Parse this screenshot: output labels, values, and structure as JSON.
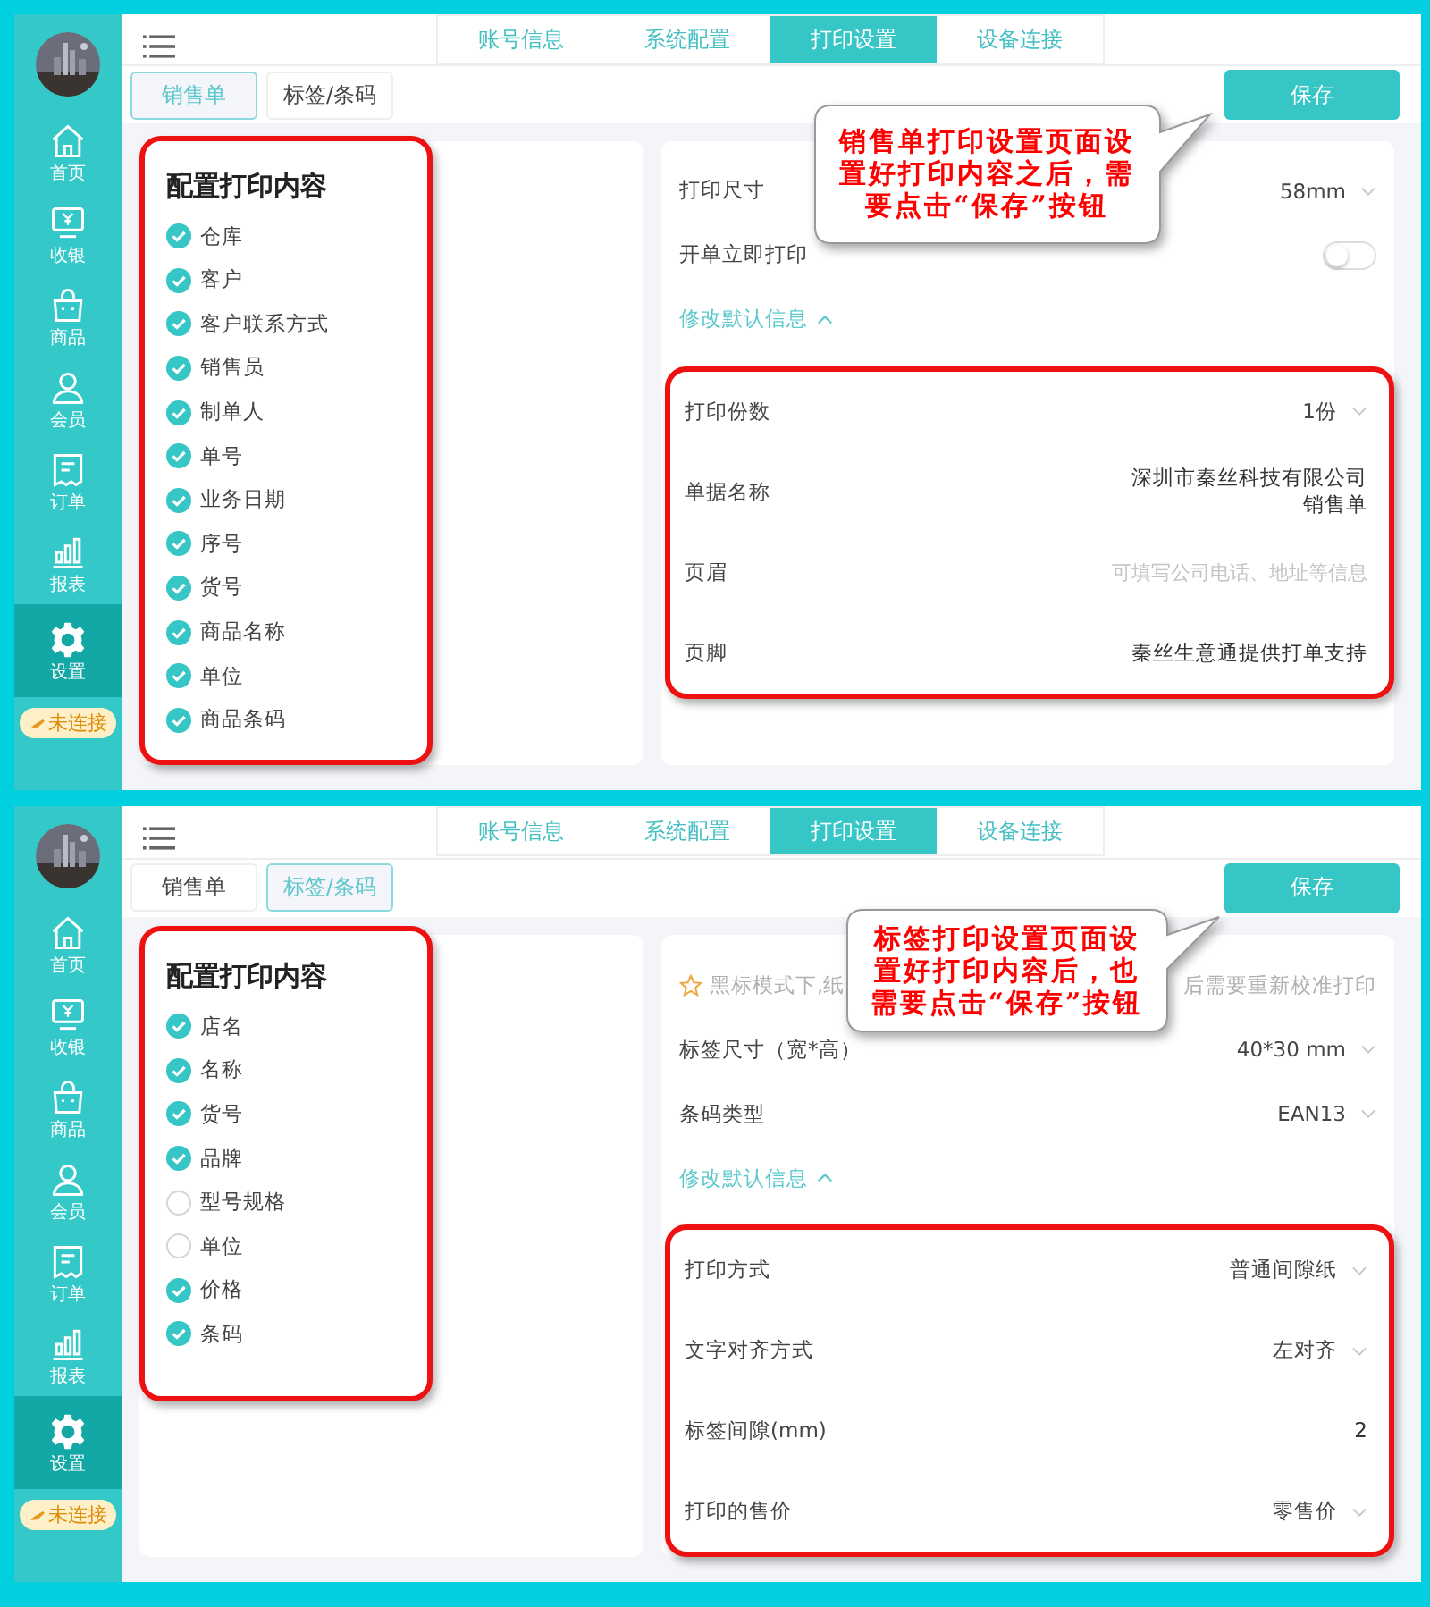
{
  "panels": [
    {
      "nav": [
        {
          "label": "首页",
          "selected": false
        },
        {
          "label": "收银",
          "selected": false
        },
        {
          "label": "商品",
          "selected": false
        },
        {
          "label": "会员",
          "selected": false
        },
        {
          "label": "订单",
          "selected": false
        },
        {
          "label": "报表",
          "selected": false
        },
        {
          "label": "设置",
          "selected": true
        }
      ],
      "status": "未连接",
      "top_tabs": [
        {
          "label": "账号信息",
          "selected": false
        },
        {
          "label": "系统配置",
          "selected": false
        },
        {
          "label": "打印设置",
          "selected": true
        },
        {
          "label": "设备连接",
          "selected": false
        }
      ],
      "sub_tabs": [
        {
          "label": "销售单",
          "selected": true
        },
        {
          "label": "标签/条码",
          "selected": false
        }
      ],
      "save": "保存",
      "content_title": "配置打印内容",
      "options": [
        {
          "label": "仓库",
          "checked": true
        },
        {
          "label": "客户",
          "checked": true
        },
        {
          "label": "客户联系方式",
          "checked": true
        },
        {
          "label": "销售员",
          "checked": true
        },
        {
          "label": "制单人",
          "checked": true
        },
        {
          "label": "单号",
          "checked": true
        },
        {
          "label": "业务日期",
          "checked": true
        },
        {
          "label": "序号",
          "checked": true
        },
        {
          "label": "货号",
          "checked": true
        },
        {
          "label": "商品名称",
          "checked": true
        },
        {
          "label": "单位",
          "checked": true
        },
        {
          "label": "商品条码",
          "checked": true
        }
      ],
      "settings": [
        {
          "kind": "select",
          "label": "打印尺寸",
          "value": "58mm"
        },
        {
          "kind": "toggle",
          "label": "开单立即打印",
          "on": false
        },
        {
          "kind": "link",
          "label": "修改默认信息",
          "expanded": true
        }
      ],
      "highlighted_settings": [
        {
          "kind": "select",
          "label": "打印份数",
          "value": "1份"
        },
        {
          "kind": "lines",
          "label": "单据名称",
          "lines": [
            "深圳市秦丝科技有限公司",
            "销售单"
          ]
        },
        {
          "kind": "hint",
          "label": "页眉",
          "placeholder": "可填写公司电话、地址等信息"
        },
        {
          "kind": "text",
          "label": "页脚",
          "value": "秦丝生意通提供打单支持"
        }
      ],
      "callout": "销售单打印设置页面设置好打印内容之后，需要点击“保存”按钮"
    },
    {
      "nav": [
        {
          "label": "首页",
          "selected": false
        },
        {
          "label": "收银",
          "selected": false
        },
        {
          "label": "商品",
          "selected": false
        },
        {
          "label": "会员",
          "selected": false
        },
        {
          "label": "订单",
          "selected": false
        },
        {
          "label": "报表",
          "selected": false
        },
        {
          "label": "设置",
          "selected": true
        }
      ],
      "status": "未连接",
      "top_tabs": [
        {
          "label": "账号信息",
          "selected": false
        },
        {
          "label": "系统配置",
          "selected": false
        },
        {
          "label": "打印设置",
          "selected": true
        },
        {
          "label": "设备连接",
          "selected": false
        }
      ],
      "sub_tabs": [
        {
          "label": "销售单",
          "selected": false
        },
        {
          "label": "标签/条码",
          "selected": true
        }
      ],
      "save": "保存",
      "content_title": "配置打印内容",
      "options": [
        {
          "label": "店名",
          "checked": true
        },
        {
          "label": "名称",
          "checked": true
        },
        {
          "label": "货号",
          "checked": true
        },
        {
          "label": "品牌",
          "checked": true
        },
        {
          "label": "型号规格",
          "checked": false
        },
        {
          "label": "单位",
          "checked": false
        },
        {
          "label": "价格",
          "checked": true
        },
        {
          "label": "条码",
          "checked": true
        }
      ],
      "notice": [
        "黑标模式下,纸",
        "后需要重新校准打印"
      ],
      "settings": [
        {
          "kind": "select",
          "label": "标签尺寸（宽*高）",
          "value": "40*30 mm"
        },
        {
          "kind": "select",
          "label": "条码类型",
          "value": "EAN13"
        },
        {
          "kind": "link",
          "label": "修改默认信息",
          "expanded": true
        }
      ],
      "highlighted_settings": [
        {
          "kind": "select",
          "label": "打印方式",
          "value": "普通间隙纸"
        },
        {
          "kind": "select",
          "label": "文字对齐方式",
          "value": "左对齐"
        },
        {
          "kind": "text",
          "label": "标签间隙(mm)",
          "value": "2"
        },
        {
          "kind": "select",
          "label": "打印的售价",
          "value": "零售价"
        }
      ],
      "callout": "标签打印设置页面设置好打印内容后，也需要点击“保存”按钮"
    }
  ]
}
